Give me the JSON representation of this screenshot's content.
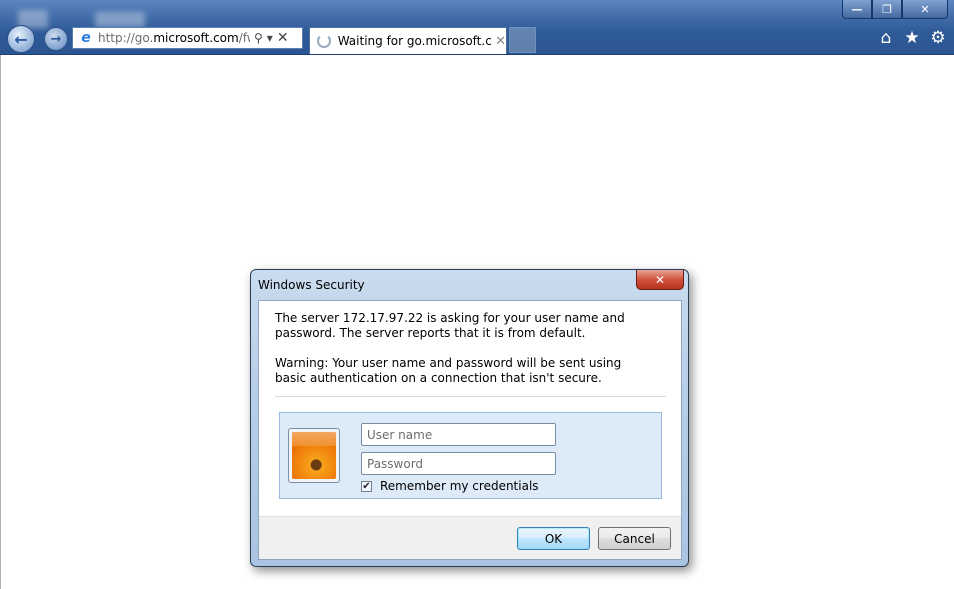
{
  "browser": {
    "address_url_prefix": "http://go.",
    "address_url_host": "microsoft.com",
    "address_url_rest": "/fwl",
    "tab_title": "Waiting for go.microsoft.co...",
    "icons": {
      "back": "back-arrow-icon",
      "forward": "forward-arrow-icon",
      "home": "home-icon",
      "favorites": "star-icon",
      "tools": "gear-icon"
    }
  },
  "dialog": {
    "title": "Windows Security",
    "message1": "The server 172.17.97.22 is asking for your user name and password. The server reports that it is from default.",
    "message2": "Warning: Your user name and password will be sent using basic authentication on a connection that isn't secure.",
    "username_placeholder": "User name",
    "username_value": "",
    "password_placeholder": "Password",
    "password_value": "",
    "remember_label": "Remember my credentials",
    "remember_checked": true,
    "ok_label": "OK",
    "cancel_label": "Cancel"
  },
  "colors": {
    "chrome_blue": "#2f5a98",
    "dialog_frame": "#b8cfe8",
    "credential_panel": "#ddeaf7",
    "close_red": "#d2543e"
  }
}
